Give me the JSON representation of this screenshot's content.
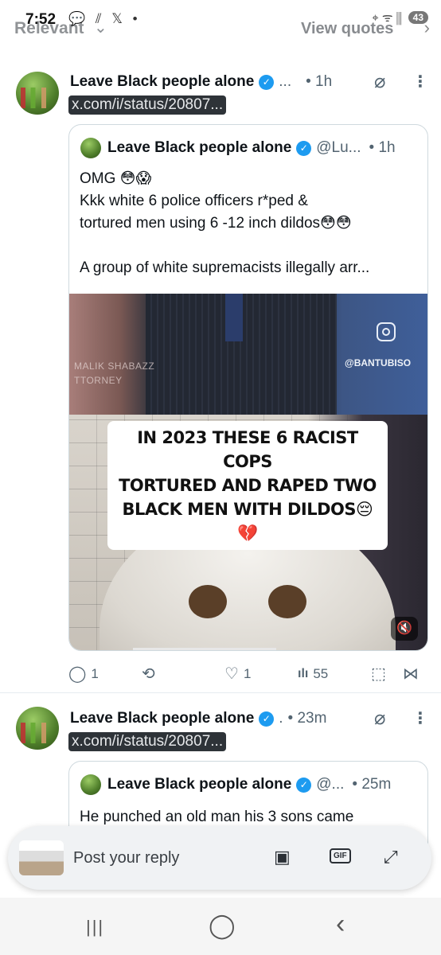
{
  "status_bar": {
    "time": "7:52",
    "left_icons": "💬 ⫽ 𝕏 •",
    "right_icons": "⌖ ᯤ ⫼",
    "battery": "43"
  },
  "header": {
    "tab_relevant": "Relevant",
    "tab_chevron": "⌄",
    "view_quotes": "View quotes",
    "view_quotes_arrow": "›"
  },
  "posts": [
    {
      "author": "Leave Black people alone",
      "handle_trunc": "...",
      "time": "• 1h",
      "link": "x.com/i/status/20807...",
      "quote": {
        "author": "Leave Black people alone",
        "handle": "@Lu...",
        "time": "• 1h",
        "lines": [
          "OMG 😳😱",
          "Kkk  white 6 police officers r*ped &",
          "tortured men using 6 -12 inch dildos😳😳",
          "",
          "A group of white supremacists illegally arr..."
        ],
        "media": {
          "overlay_left": "MALIK SHABAZZ",
          "overlay_left_2": "TTORNEY",
          "watermark": "@BANTUBISO",
          "caption_lines": [
            "IN 2023 THESE 6 RACIST COPS",
            "TORTURED AND RAPED TWO",
            "BLACK MEN WITH DILDOS😔💔"
          ]
        }
      },
      "actions": {
        "replies": "1",
        "reposts": "",
        "likes": "1",
        "views": "55"
      }
    },
    {
      "author": "Leave Black people alone",
      "handle_trunc": ".",
      "time": "• 23m",
      "link": "x.com/i/status/20807...",
      "quote": {
        "author": "Leave Black people alone",
        "handle": "@...",
        "time": "• 25m",
        "lines": [
          "He punched an old man his 3 sons came"
        ]
      }
    }
  ],
  "reply_bar": {
    "placeholder": "Post your reply",
    "gif_label": "GIF"
  },
  "icons": {
    "verified": "✓",
    "grok": "⌀",
    "more": "⋮",
    "reply": "◯",
    "repost": "⟲",
    "like": "♡",
    "views": "ılı",
    "bookmark": "⬚",
    "share": "⋈",
    "mute": "🔇",
    "image": "▣",
    "expand": "⤢",
    "nav_recents": "|||",
    "nav_home": "◯",
    "nav_back": "‹"
  },
  "colors": {
    "verified_blue": "#1d9bf0",
    "muted_text": "#536471",
    "link_pill_bg": "#2e3338"
  }
}
